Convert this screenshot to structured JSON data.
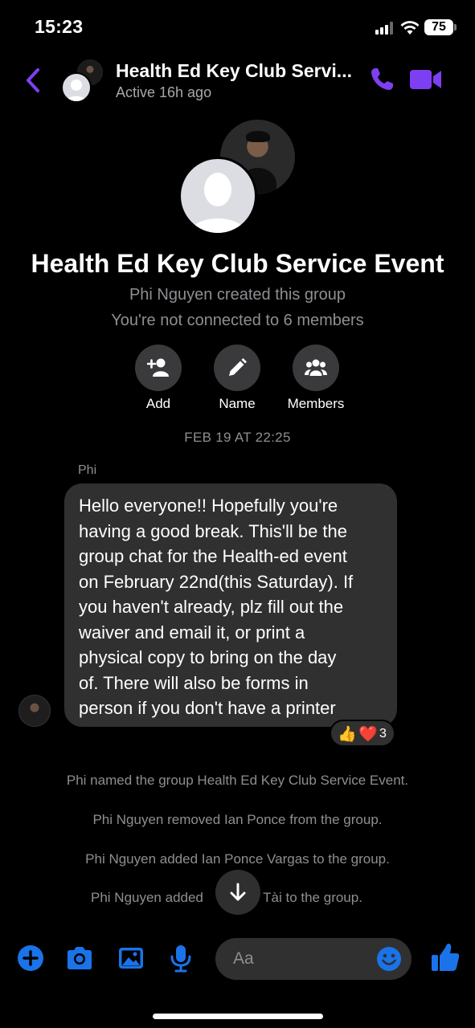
{
  "status_bar": {
    "time": "15:23",
    "battery": "75"
  },
  "header": {
    "title": "Health Ed Key Club Servi...",
    "subtitle": "Active 16h ago",
    "icons": [
      "back-chevron-icon",
      "phone-icon",
      "video-camera-icon"
    ]
  },
  "group": {
    "name": "Health Ed Key Club Service Event",
    "created_by": "Phi Nguyen created this group",
    "connection": "You're not connected to 6 members",
    "actions": [
      {
        "label": "Add",
        "icon": "add-person-icon"
      },
      {
        "label": "Name",
        "icon": "pencil-icon"
      },
      {
        "label": "Members",
        "icon": "people-icon"
      }
    ]
  },
  "conversation": {
    "date": "FEB 19 AT 22:25",
    "message": {
      "sender": "Phi",
      "lines": [
        "Hello everyone!! Hopefully you're",
        "having a good break. This'll be the",
        "group chat for the Health-ed event",
        "on February 22nd(this Saturday). If",
        "you haven't already, plz fill out the",
        "waiver and email it, or print a",
        "physical copy to bring on the day",
        "of. There will also be forms in",
        "person if you don't have a printer"
      ],
      "reactions": {
        "like": "👍",
        "heart": "❤️",
        "count": "3"
      }
    },
    "system_messages": [
      "Phi named the group Health Ed Key Club Service Event.",
      "Phi Nguyen removed Ian Ponce from the group.",
      "Phi Nguyen added Ian Ponce Vargas to the group.",
      "Phi Nguyen added",
      ". Tài to the group."
    ]
  },
  "composer": {
    "placeholder": "Aa",
    "icons": [
      "plus-icon",
      "camera-icon",
      "photo-icon",
      "microphone-icon",
      "emoji-icon",
      "thumbs-up-icon"
    ]
  },
  "colors": {
    "accent": "#7e3ff2",
    "composer_blue": "#1a73e8",
    "bubble": "#303030"
  }
}
